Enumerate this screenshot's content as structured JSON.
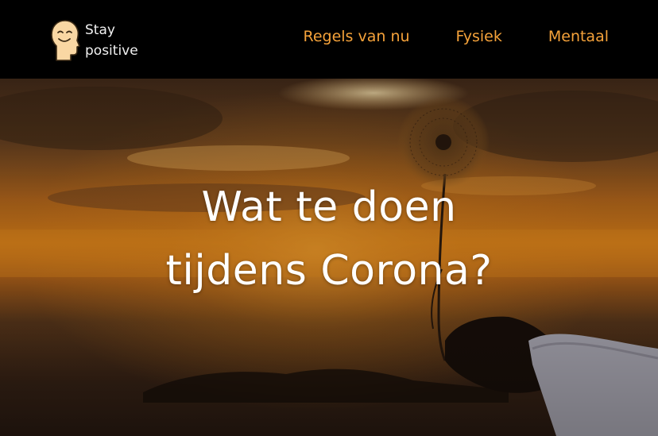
{
  "brand": {
    "line1": "Stay",
    "line2": "positive",
    "icon": "smiling-head-icon"
  },
  "nav": {
    "items": [
      {
        "label": "Regels van nu"
      },
      {
        "label": "Fysiek"
      },
      {
        "label": "Mentaal"
      }
    ]
  },
  "hero": {
    "title_line1": "Wat te doen",
    "title_line2": "tijdens Corona?",
    "image": "sunset-dandelion-photo"
  },
  "colors": {
    "header_bg": "#000000",
    "nav_accent": "#f5a23a",
    "hero_text": "#ffffff",
    "sunset_orange": "#e08a1a"
  }
}
